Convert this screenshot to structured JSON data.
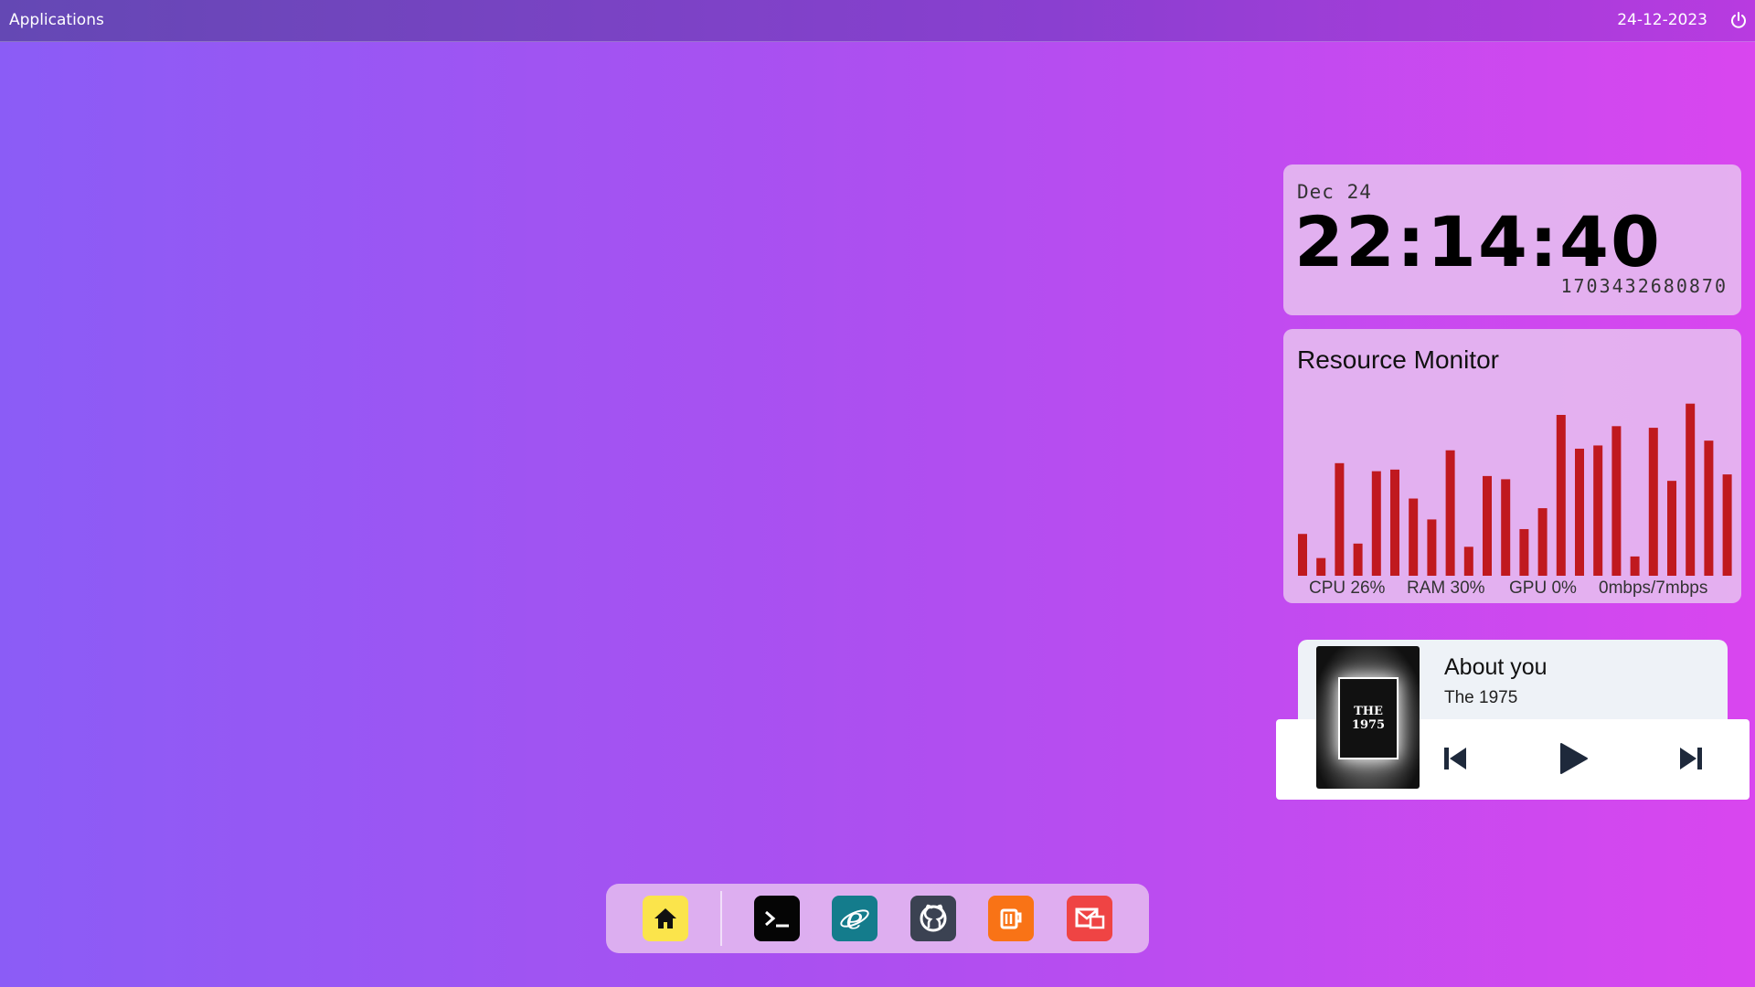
{
  "topbar": {
    "apps_label": "Applications",
    "date": "24-12-2023"
  },
  "clock": {
    "day": "Dec 24",
    "time": "22:14:40",
    "epoch": "1703432680870"
  },
  "resource_monitor": {
    "title": "Resource Monitor",
    "bar_color": "#c0191f",
    "stats": {
      "cpu": "CPU 26%",
      "ram": "RAM 30%",
      "gpu": "GPU 0%",
      "net": "0mbps/7mbps"
    },
    "bars": [
      0.26,
      0.11,
      0.7,
      0.2,
      0.65,
      0.66,
      0.48,
      0.35,
      0.78,
      0.18,
      0.62,
      0.6,
      0.29,
      0.42,
      1.0,
      0.79,
      0.81,
      0.93,
      0.12,
      0.92,
      0.59,
      1.07,
      0.84,
      0.63
    ]
  },
  "player": {
    "title": "About you",
    "artist": "The 1975",
    "album_text": "THE 1975"
  },
  "dock": {
    "items": [
      {
        "name": "home",
        "bg": "#fbe44b"
      },
      {
        "name": "terminal",
        "bg": "#050505"
      },
      {
        "name": "browser",
        "bg": "#147c8c"
      },
      {
        "name": "github",
        "bg": "#3b4252"
      },
      {
        "name": "notes",
        "bg": "#f97316"
      },
      {
        "name": "mail",
        "bg": "#ef4444"
      }
    ]
  }
}
